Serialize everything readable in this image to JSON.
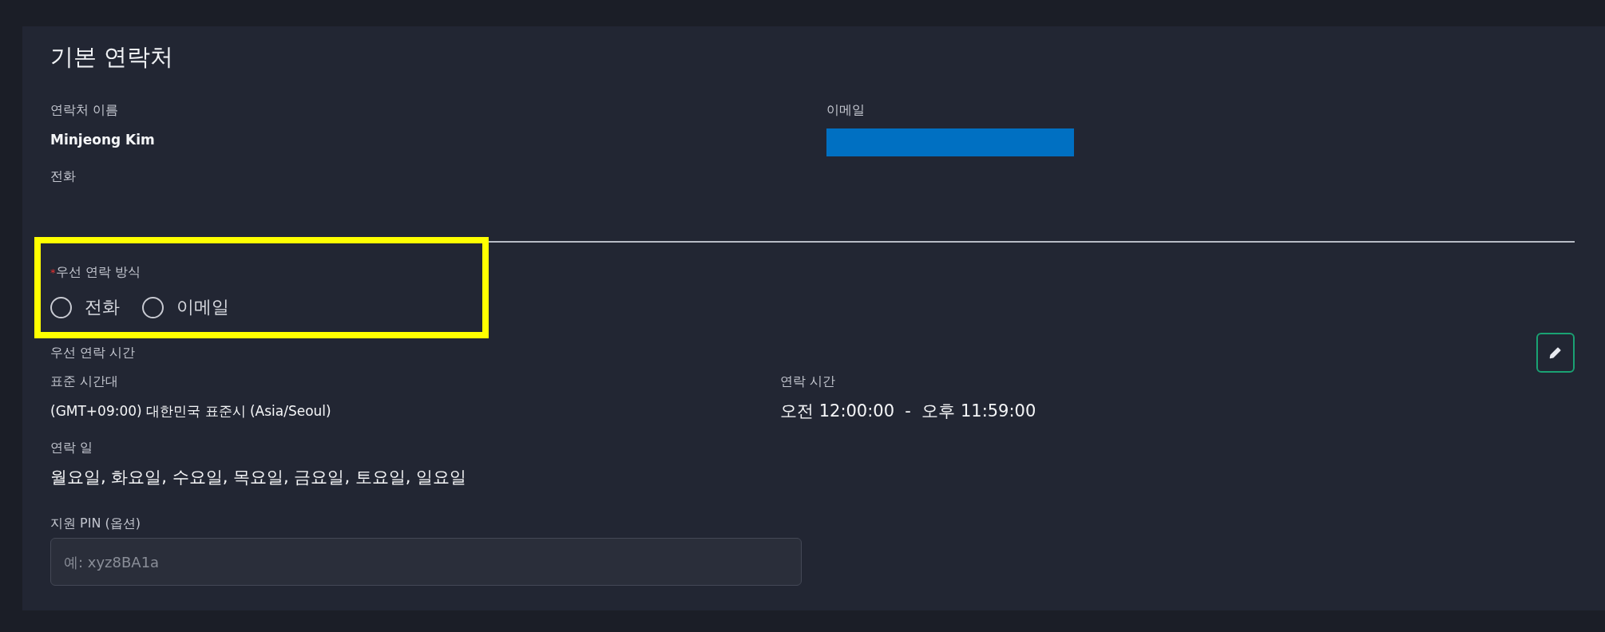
{
  "card": {
    "title": "기본 연락처",
    "contact_name": {
      "label": "연락처 이름",
      "value": "Minjeong Kim"
    },
    "phone": {
      "label": "전화"
    },
    "email": {
      "label": "이메일",
      "redacted": true
    },
    "preferred_method": {
      "highlighted": true,
      "required_mark": "*",
      "label": "우선 연락 방식",
      "options": [
        {
          "label": "전화",
          "selected": false
        },
        {
          "label": "이메일",
          "selected": false
        }
      ]
    },
    "preferred_time": {
      "label": "우선 연락 시간",
      "timezone": {
        "label": "표준 시간대",
        "value": "(GMT+09:00) 대한민국 표준시 (Asia/Seoul)"
      },
      "hours": {
        "label": "연락 시간",
        "value": "오전 12:00:00  -  오후 11:59:00"
      },
      "days": {
        "label": "연락 일",
        "value": "월요일, 화요일, 수요일, 목요일, 금요일, 토요일, 일요일"
      }
    },
    "pin": {
      "label": "지원 PIN (옵션)",
      "placeholder": "예: xyz8BA1a"
    }
  }
}
